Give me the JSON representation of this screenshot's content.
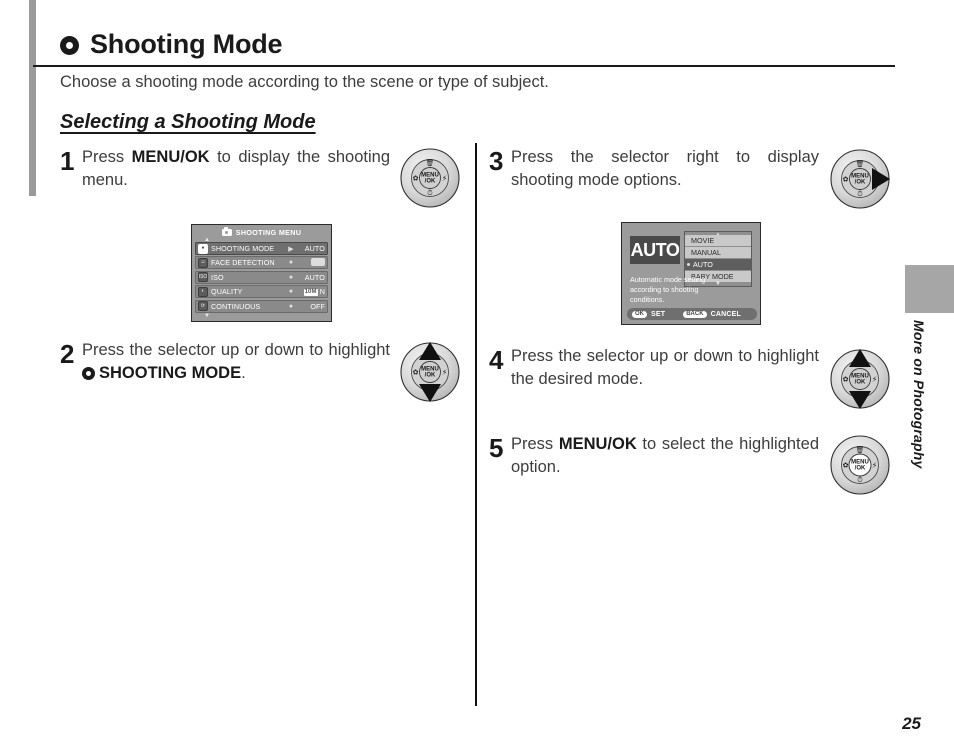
{
  "header": {
    "icon": "shooting-mode-dot-icon",
    "title": "Shooting Mode",
    "intro": "Choose a shooting mode according to the scene or type of subject."
  },
  "section": {
    "heading": "Selecting a Shooting Mode"
  },
  "steps": [
    {
      "num": "1",
      "text_before": "Press ",
      "bold": "MENU/OK",
      "text_after": " to display the shooting menu."
    },
    {
      "num": "2",
      "text_before": "Press the selector up or down to highlight ",
      "bold": "SHOOTING MODE",
      "text_after": "."
    },
    {
      "num": "3",
      "text_before": "Press the selector right to display shooting mode options.",
      "bold": "",
      "text_after": ""
    },
    {
      "num": "4",
      "text_before": "Press the selector up or down to highlight the desired mode.",
      "bold": "",
      "text_after": ""
    },
    {
      "num": "5",
      "text_before": "Press ",
      "bold": "MENU/OK",
      "text_after": " to select the highlighted option."
    }
  ],
  "selector": {
    "center_line1": "MENU",
    "center_line2": "/OK",
    "left_icon": "macro-flower-icon",
    "right_icon": "flash-bolt-icon",
    "top_icon": "delete-trash-icon",
    "bottom_icon": "self-timer-clock-icon"
  },
  "lcd_menu": {
    "title": "SHOOTING MENU",
    "title_icon": "camera-icon",
    "rows": [
      {
        "icon": "camera-icon",
        "label": "SHOOTING MODE",
        "mark": "▶",
        "value": "AUTO",
        "selected": true
      },
      {
        "icon": "face-icon",
        "label": "FACE DETECTION",
        "mark": "●",
        "value": "face-detection-glyph",
        "selected": false
      },
      {
        "icon": "iso-icon",
        "label": "ISO",
        "mark": "●",
        "value": "AUTO",
        "selected": false
      },
      {
        "icon": "quality-icon",
        "label": "QUALITY",
        "mark": "●",
        "value": "10M N",
        "selected": false
      },
      {
        "icon": "continuous-icon",
        "label": "CONTINUOUS",
        "mark": "●",
        "value": "OFF",
        "selected": false
      }
    ]
  },
  "lcd_auto": {
    "badge": "AUTO",
    "options": [
      {
        "label": "MOVIE",
        "highlighted": false
      },
      {
        "label": "MANUAL",
        "highlighted": false
      },
      {
        "label": "AUTO",
        "highlighted": true
      },
      {
        "label": "BABY MODE",
        "highlighted": false
      }
    ],
    "description": "Automatic mode setting according to shooting conditions.",
    "bar": {
      "ok_key": "OK",
      "ok_label": "SET",
      "back_key": "BACK",
      "back_label": "CANCEL"
    }
  },
  "side_tab": {
    "label": "More on Photography"
  },
  "footer": {
    "page_number": "25"
  },
  "colors": {
    "ink": "#1a1a1a",
    "body_text": "#3d3d3d",
    "lcd_bg": "#9b9b9b",
    "tab_gray": "#a6a6a6",
    "spine_gray": "#9a9a9a"
  }
}
